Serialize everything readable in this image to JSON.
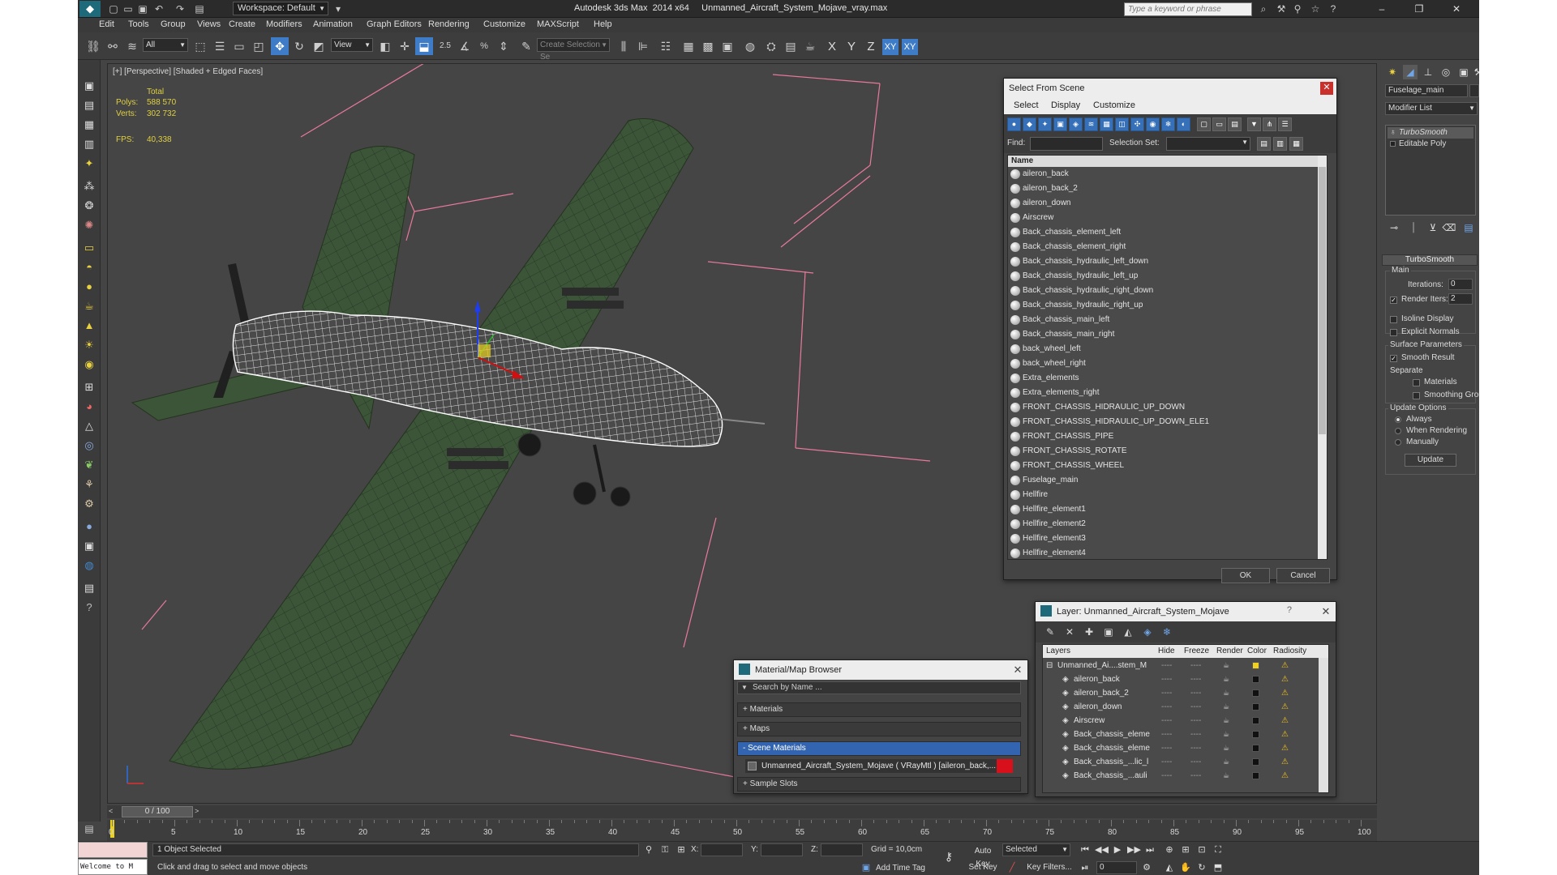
{
  "titlebar": {
    "workspace": "Workspace: Default",
    "title": "Autodesk 3ds Max  2014 x64     Unmanned_Aircraft_System_Mojave_vray.max",
    "search_placeholder": "Type a keyword or phrase"
  },
  "menu": [
    "Edit",
    "Tools",
    "Group",
    "Views",
    "Create",
    "Modifiers",
    "Animation",
    "Graph Editors",
    "Rendering",
    "Customize",
    "MAXScript",
    "Help"
  ],
  "toolbar": {
    "selection_filter": "All",
    "ref_coord": "View",
    "snap_angle": "2.5",
    "named_selection_placeholder": "Create Selection Se",
    "axis": [
      "X",
      "Y",
      "Z",
      "XY",
      "XY"
    ]
  },
  "viewport": {
    "label": "[+] [Perspective] [Shaded + Edged Faces]",
    "stats": {
      "total_label": "Total",
      "polys_label": "Polys:",
      "polys_value": "588 570",
      "verts_label": "Verts:",
      "verts_value": "302 732",
      "fps_label": "FPS:",
      "fps_value": "40,338"
    }
  },
  "select_from_scene": {
    "title": "Select From Scene",
    "menu": [
      "Select",
      "Display",
      "Customize"
    ],
    "find_label": "Find:",
    "selection_set_label": "Selection Set:",
    "column_name": "Name",
    "items": [
      "aileron_back",
      "aileron_back_2",
      "aileron_down",
      "Airscrew",
      "Back_chassis_element_left",
      "Back_chassis_element_right",
      "Back_chassis_hydraulic_left_down",
      "Back_chassis_hydraulic_left_up",
      "Back_chassis_hydraulic_right_down",
      "Back_chassis_hydraulic_right_up",
      "Back_chassis_main_left",
      "Back_chassis_main_right",
      "back_wheel_left",
      "back_wheel_right",
      "Extra_elements",
      "Extra_elements_right",
      "FRONT_CHASSIS_HIDRAULIC_UP_DOWN",
      "FRONT_CHASSIS_HIDRAULIC_UP_DOWN_ELE1",
      "FRONT_CHASSIS_PIPE",
      "FRONT_CHASSIS_ROTATE",
      "FRONT_CHASSIS_WHEEL",
      "Fuselage_main",
      "Hellfire",
      "Hellfire_element1",
      "Hellfire_element2",
      "Hellfire_element3",
      "Hellfire_element4"
    ],
    "ok": "OK",
    "cancel": "Cancel"
  },
  "layer_dialog": {
    "title": "Layer: Unmanned_Aircraft_System_Mojave",
    "help": "?",
    "columns": [
      "Layers",
      "Hide",
      "Freeze",
      "Render",
      "Color",
      "Radiosity"
    ],
    "rows": [
      "Unmanned_Ai....stem_M",
      "aileron_back",
      "aileron_back_2",
      "aileron_down",
      "Airscrew",
      "Back_chassis_eleme",
      "Back_chassis_eleme",
      "Back_chassis_...lic_l",
      "Back_chassis_...auli"
    ],
    "dash": "----",
    "layer_color": "#f0d020"
  },
  "material_browser": {
    "title": "Material/Map Browser",
    "search_placeholder": "Search by Name ...",
    "sections": [
      "+ Materials",
      "+ Maps",
      "- Scene Materials",
      "+ Sample Slots"
    ],
    "scene_material": "Unmanned_Aircraft_System_Mojave  ( VRayMtl )  [aileron_back,..."
  },
  "command_panel": {
    "object_name": "Fuselage_main",
    "modifier_list": "Modifier List",
    "stack": [
      "TurboSmooth",
      "Editable Poly"
    ],
    "rollout": "TurboSmooth",
    "main_label": "Main",
    "iterations_label": "Iterations:",
    "iterations_value": "0",
    "render_iters_label": "Render Iters:",
    "render_iters_value": "2",
    "isoline": "Isoline Display",
    "explicit_normals": "Explicit Normals",
    "surface_params": "Surface Parameters",
    "smooth_result": "Smooth Result",
    "separate": "Separate",
    "materials": "Materials",
    "smoothing_groups": "Smoothing Groups",
    "update_options": "Update Options",
    "always": "Always",
    "when_rendering": "When Rendering",
    "manually": "Manually",
    "update_btn": "Update"
  },
  "timeline": {
    "frame": "0 / 100",
    "ticks": [
      "0",
      "5",
      "10",
      "15",
      "20",
      "25",
      "30",
      "35",
      "40",
      "45",
      "50",
      "55",
      "60",
      "65",
      "70",
      "75",
      "80",
      "85",
      "90",
      "95",
      "100"
    ]
  },
  "statusbar": {
    "maxscript_out": "Welcome to M",
    "selected": "1 Object Selected",
    "prompt": "Click and drag to select and move objects",
    "x_label": "X:",
    "y_label": "Y:",
    "z_label": "Z:",
    "grid": "Grid = 10,0cm",
    "add_time_tag": "Add Time Tag",
    "auto_key": "Auto Key",
    "set_key": "Set Key",
    "key_mode": "Selected",
    "key_filters": "Key Filters...",
    "current_frame": "0"
  },
  "colors": {
    "accent": "#3f7cc8",
    "wing": "#3c5538",
    "wireframe": "#ffffff",
    "bounding_box": "#e8799a"
  }
}
